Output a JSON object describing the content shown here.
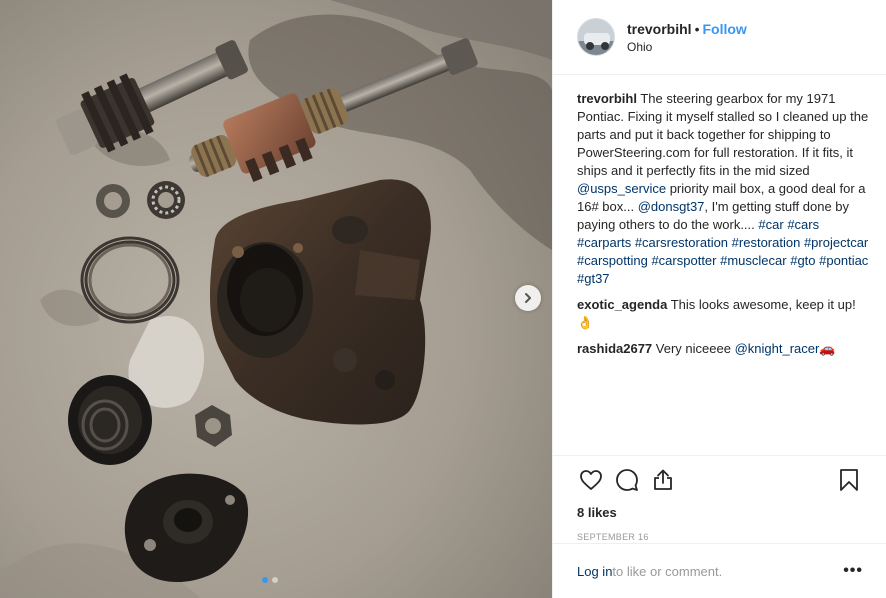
{
  "header": {
    "username": "trevorbihl",
    "separator": "•",
    "follow_label": "Follow",
    "location": "Ohio"
  },
  "caption": {
    "username": "trevorbihl",
    "text_1": "The steering gearbox for my 1971 Pontiac. Fixing it myself stalled so I cleaned up the parts and put it back together for shipping to PowerSteering.com for full restoration. If it fits, it ships and it perfectly fits in the mid sized ",
    "mention_1": "@usps_service",
    "text_2": " priority mail box, a good deal for a 16# box... ",
    "mention_2": "@donsgt37",
    "text_3": ", I'm getting stuff done by paying others to do the work....",
    "hashtags": [
      "#car",
      "#cars",
      "#carparts",
      "#carsrestoration",
      "#restoration",
      "#projectcar",
      "#carspotting",
      "#carspotter",
      "#musclecar",
      "#gto",
      "#pontiac",
      "#gt37"
    ]
  },
  "comments": [
    {
      "username": "exotic_agenda",
      "text": "This looks awesome, keep it up!👌"
    },
    {
      "username": "rashida2677",
      "text": "Very niceeee ",
      "mention": "@knight_racer",
      "emoji": "🚗"
    }
  ],
  "actions": {
    "like_icon": "heart-icon",
    "comment_icon": "comment-icon",
    "share_icon": "share-icon",
    "save_icon": "bookmark-icon"
  },
  "likes_text": "8 likes",
  "date_text": "SEPTEMBER 16",
  "login": {
    "link_label": "Log in",
    "rest_text": " to like or comment.",
    "more_label": "•••"
  },
  "carousel": {
    "next_icon": "chevron-right-icon",
    "slide_count": 2,
    "active_slide": 1
  },
  "colors": {
    "accent": "#3897f0",
    "link": "#003569",
    "muted": "#999999",
    "text": "#262626",
    "border": "#efefef"
  }
}
